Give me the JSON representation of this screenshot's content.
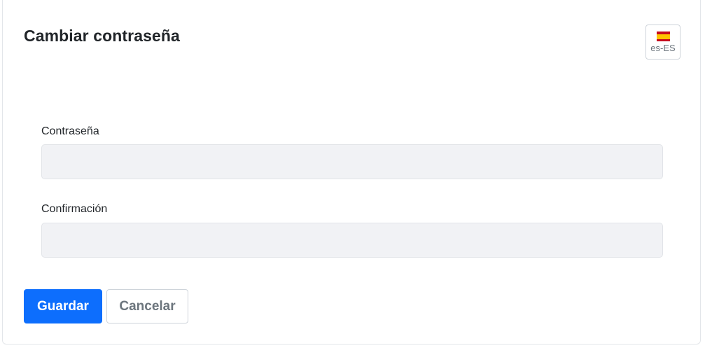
{
  "page": {
    "title": "Cambiar contraseña"
  },
  "language": {
    "code": "es-ES",
    "flag_icon": "spain-flag-icon",
    "flag_colors": {
      "red": "#c60b1e",
      "yellow": "#ffc400"
    }
  },
  "form": {
    "password": {
      "label": "Contraseña",
      "value": "",
      "placeholder": ""
    },
    "confirmation": {
      "label": "Confirmación",
      "value": "",
      "placeholder": ""
    }
  },
  "actions": {
    "save_label": "Guardar",
    "cancel_label": "Cancelar",
    "primary_color": "#0d6efd"
  }
}
